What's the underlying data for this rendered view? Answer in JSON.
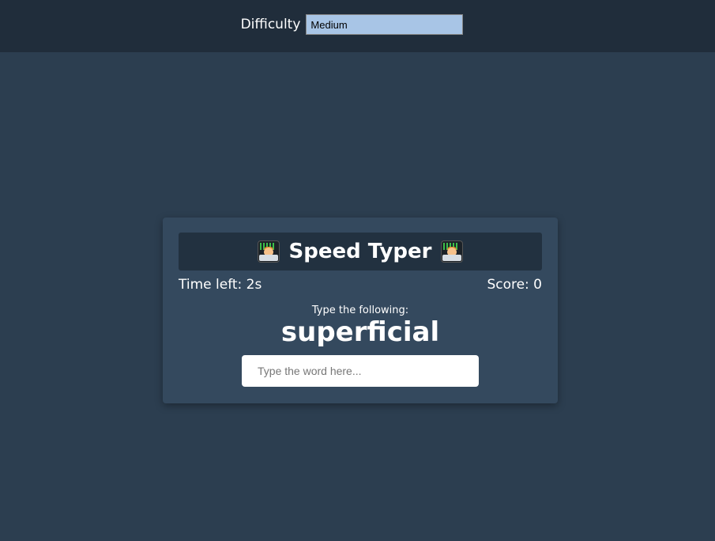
{
  "difficulty": {
    "label": "Difficulty",
    "selected": "Medium"
  },
  "game": {
    "title": "Speed Typer",
    "title_icon": "technologist-emoji",
    "time_label": "Time left: 2s",
    "score_label": "Score: 0",
    "prompt": "Type the following:",
    "word": "superficial",
    "input_placeholder": "Type the word here..."
  },
  "colors": {
    "background": "#2c3e50",
    "topbar": "#202d3b",
    "card": "#34495e",
    "title_box": "#223140",
    "select_bg": "#a8c5e6"
  }
}
